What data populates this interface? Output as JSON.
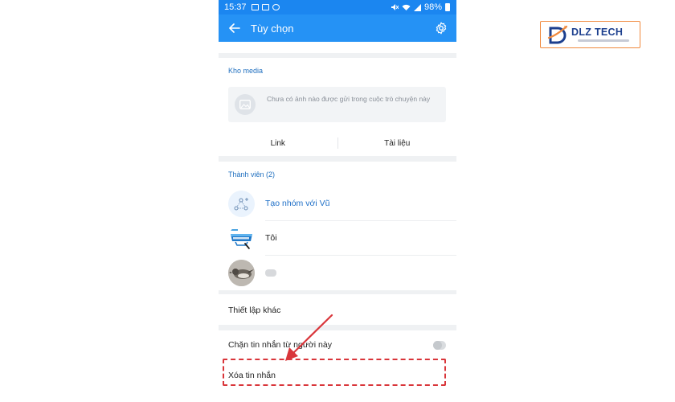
{
  "status_bar": {
    "time": "15:37",
    "battery": "98%"
  },
  "app_bar": {
    "title": "Tùy chọn"
  },
  "media": {
    "section_title": "Kho media",
    "empty_text": "Chưa có ảnh nào được gửi trong cuộc trò chuyện này",
    "tabs": [
      "Link",
      "Tài liệu"
    ]
  },
  "members": {
    "section_title": "Thành viên (2)",
    "items": [
      {
        "name": "Tạo nhóm với Vũ",
        "icon": "group-add-icon"
      },
      {
        "name": "Tôi",
        "icon": "download-badge-avatar"
      },
      {
        "name": "",
        "icon": "bird-photo-avatar"
      }
    ]
  },
  "other_settings": {
    "label": "Thiết lập khác"
  },
  "block_messages": {
    "label": "Chặn tin nhắn từ người này",
    "enabled": false
  },
  "delete_messages": {
    "label": "Xóa tin nhắn"
  },
  "logo": {
    "text": "DLZ TECH"
  },
  "colors": {
    "app_bar": "#2592f5",
    "status_bar": "#1b86f0",
    "accent_text": "#1e6fc7",
    "annotation_red": "#d9353a",
    "logo_blue": "#1c3f8e",
    "logo_orange": "#f08a3e"
  }
}
